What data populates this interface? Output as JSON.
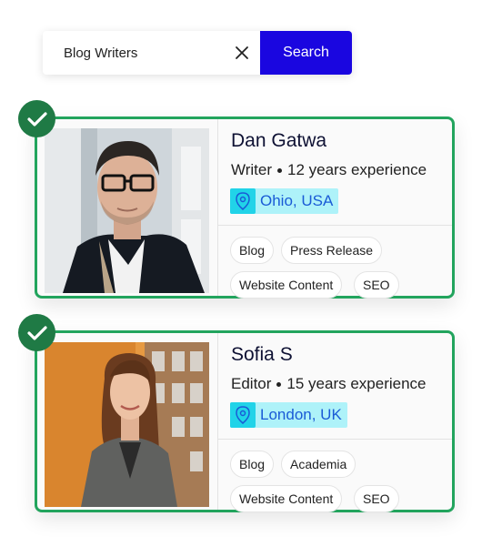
{
  "search": {
    "value": "Blog Writers",
    "button_label": "Search"
  },
  "writers": [
    {
      "name": "Dan Gatwa",
      "role": "Writer",
      "experience": "12 years experience",
      "location": "Ohio, USA",
      "tags": [
        "Blog",
        "Press Release",
        "Website Content",
        "SEO"
      ]
    },
    {
      "name": "Sofia S",
      "role": "Editor",
      "experience": "15 years experience",
      "location": "London, UK",
      "tags": [
        "Blog",
        "Academia",
        "Website Content",
        "SEO"
      ]
    }
  ],
  "colors": {
    "card_border": "#22a45d",
    "check_badge": "#1f7a45",
    "search_button": "#1a06e0",
    "location_bg": "#aef2f9",
    "location_pin_bg": "#21d3e8",
    "location_text": "#1a5bd6"
  },
  "icons": {
    "clear": "close-icon",
    "selected": "checkmark-icon",
    "location": "location-pin-icon"
  }
}
